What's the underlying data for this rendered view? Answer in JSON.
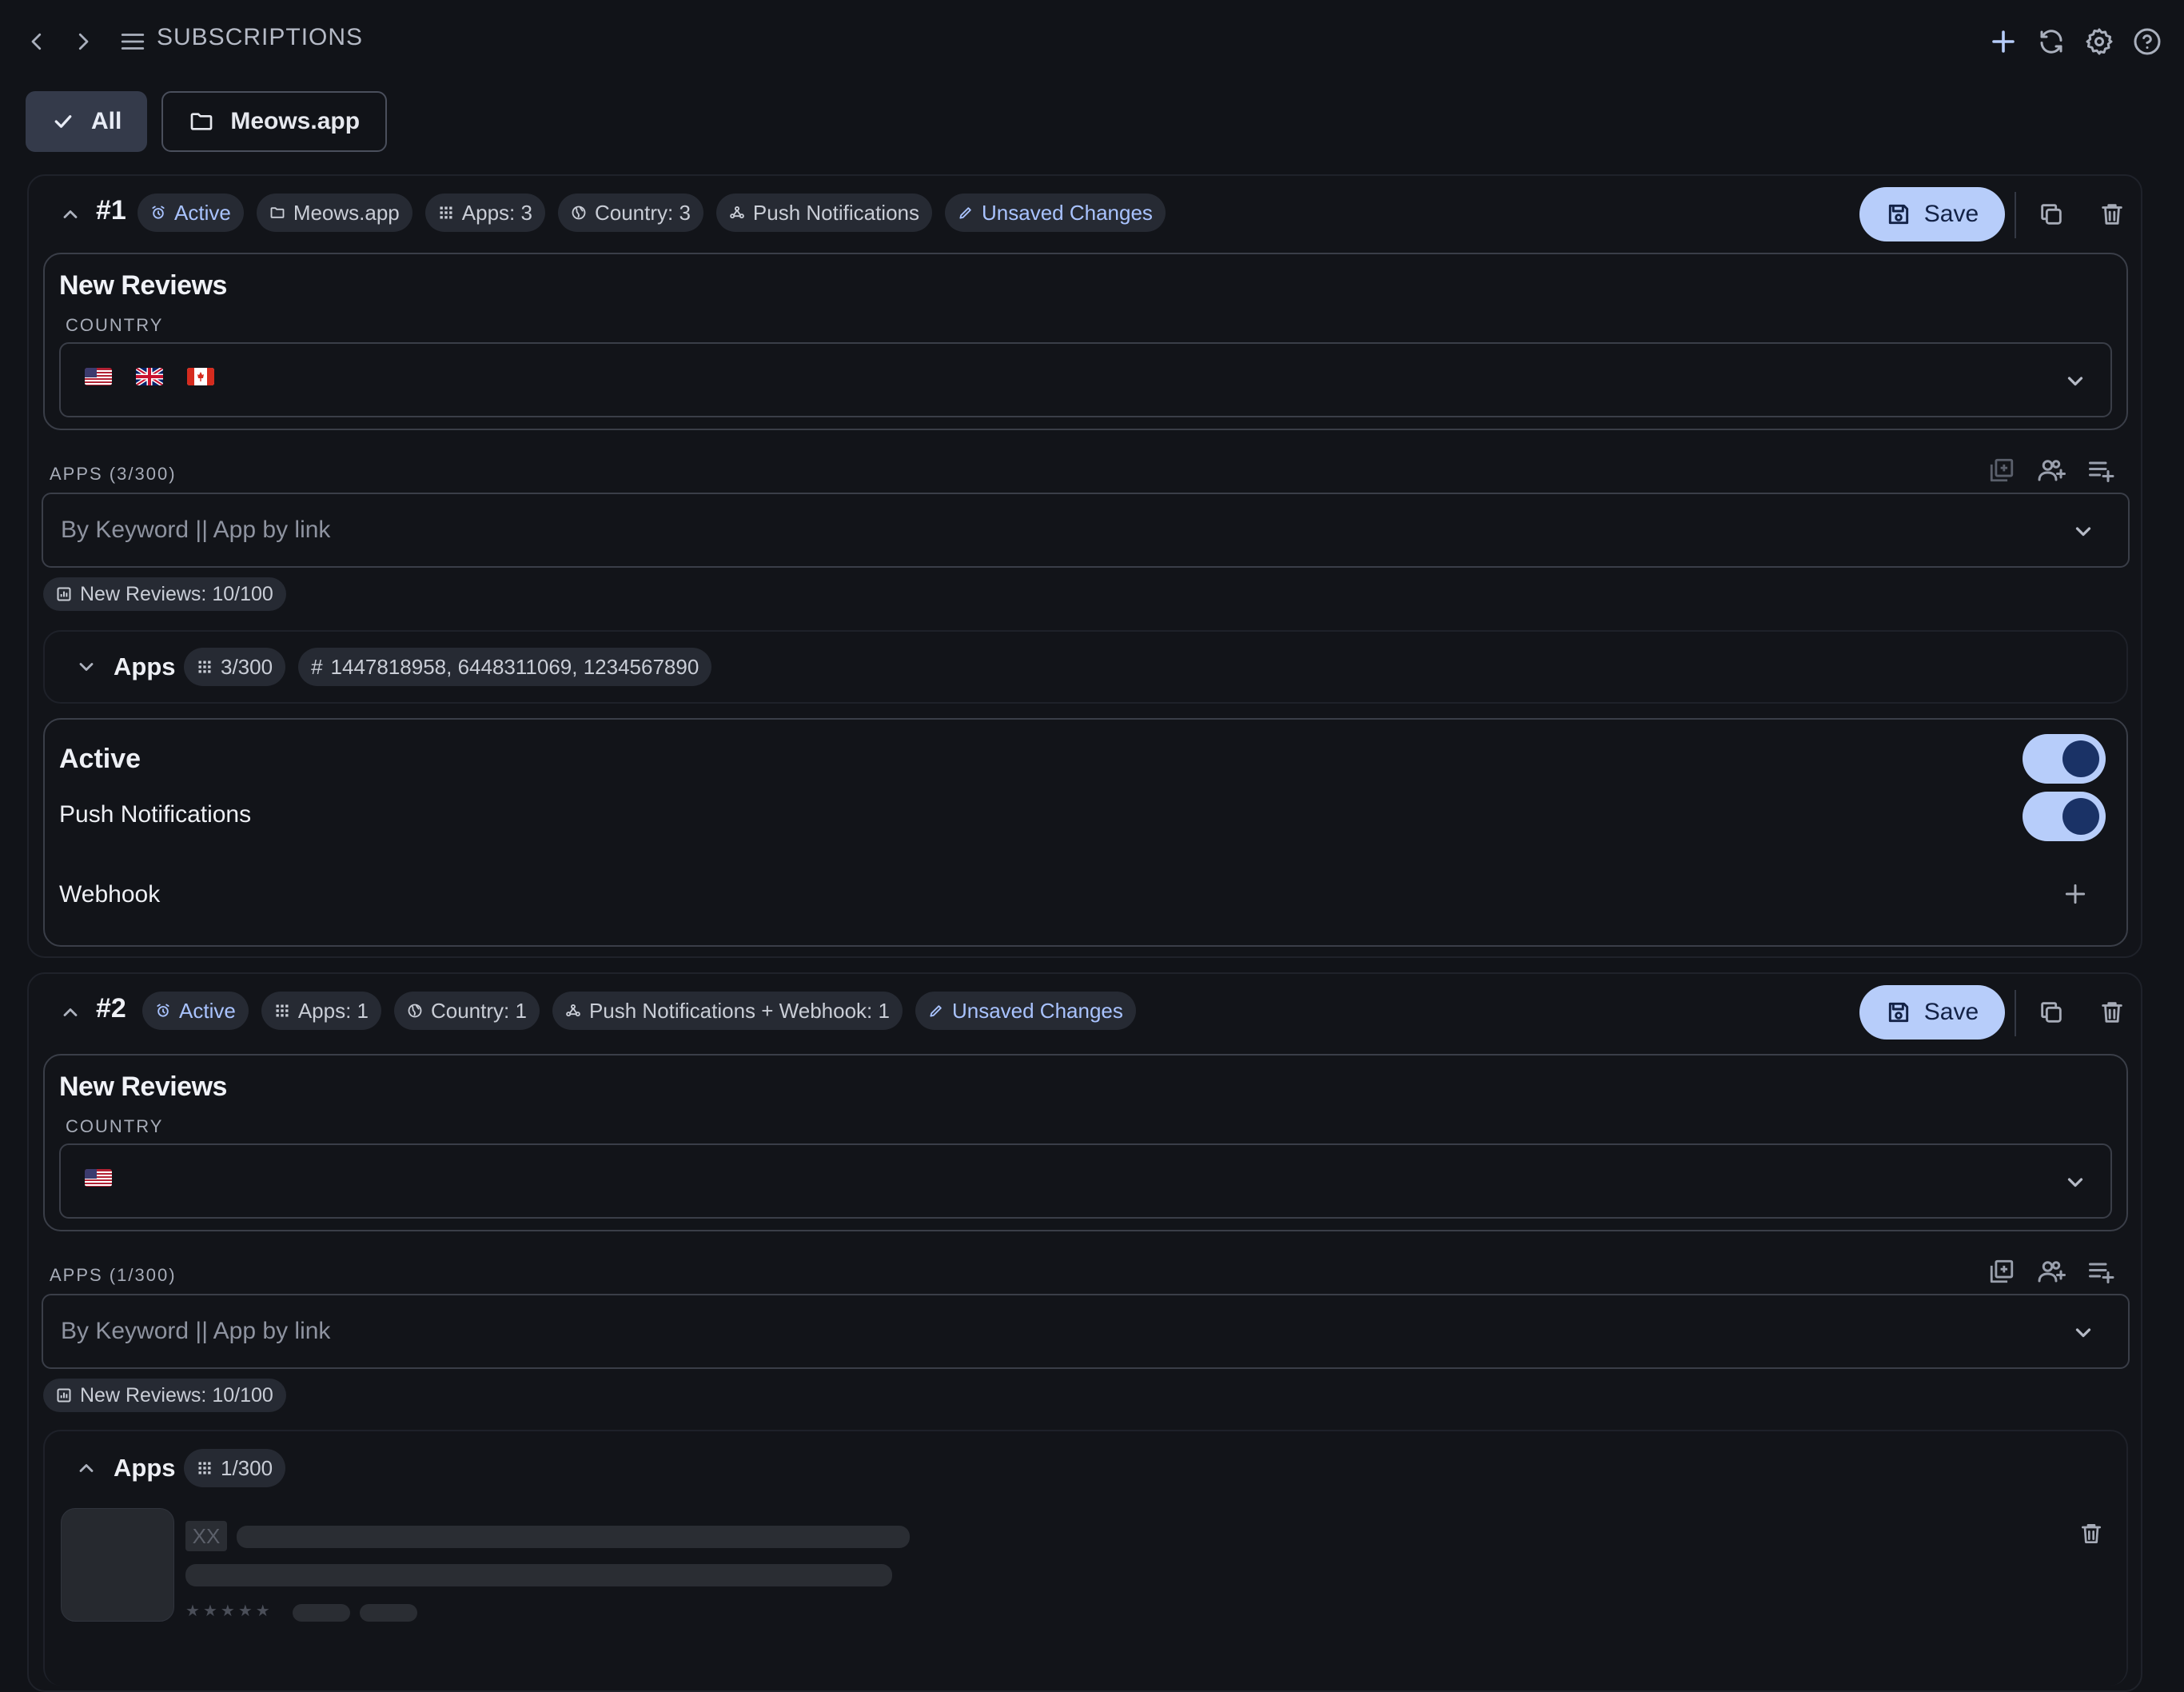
{
  "header": {
    "title": "SUBSCRIPTIONS",
    "icons": [
      "chevron-left-icon",
      "chevron-right-icon",
      "menu-icon",
      "plus-icon",
      "refresh-icon",
      "gear-icon",
      "help-icon"
    ]
  },
  "filters": [
    {
      "label": "All",
      "icon": "check-icon",
      "selected": true
    },
    {
      "label": "Meows.app",
      "icon": "folder-icon",
      "selected": false
    }
  ],
  "subscriptions": [
    {
      "number": "#1",
      "chips": {
        "active": "Active",
        "folder": "Meows.app",
        "apps": "Apps: 3",
        "country": "Country: 3",
        "notify": "Push Notifications",
        "unsaved": "Unsaved Changes"
      },
      "save_label": "Save",
      "filter_title": "New Reviews",
      "country_label": "COUNTRY",
      "countries": [
        "US",
        "GB",
        "CA"
      ],
      "apps_label": "APPS (3/300)",
      "search_placeholder": "By Keyword || App by link",
      "quota_chip": "New Reviews: 10/100",
      "apps_section": {
        "title": "Apps",
        "count": "3/300",
        "ids": "1447818958, 6448311069, 1234567890",
        "expanded": false
      },
      "settings": {
        "active_label": "Active",
        "active_on": true,
        "push_label": "Push Notifications",
        "push_on": true,
        "webhook_label": "Webhook"
      }
    },
    {
      "number": "#2",
      "chips": {
        "active": "Active",
        "apps": "Apps: 1",
        "country": "Country: 1",
        "notify": "Push Notifications + Webhook: 1",
        "unsaved": "Unsaved Changes"
      },
      "save_label": "Save",
      "filter_title": "New Reviews",
      "country_label": "COUNTRY",
      "countries": [
        "US"
      ],
      "apps_label": "APPS (1/300)",
      "search_placeholder": "By Keyword || App by link",
      "quota_chip": "New Reviews: 10/100",
      "apps_section": {
        "title": "Apps",
        "count": "1/300",
        "expanded": true,
        "placeholder_badge": "XX",
        "rating_stars": 5
      }
    }
  ],
  "colors": {
    "background": "#111318",
    "accent": "#b7cdfa",
    "accent_text": "#132246",
    "chip_bg": "#262a33",
    "chip_blue_text": "#a9c3ff"
  }
}
